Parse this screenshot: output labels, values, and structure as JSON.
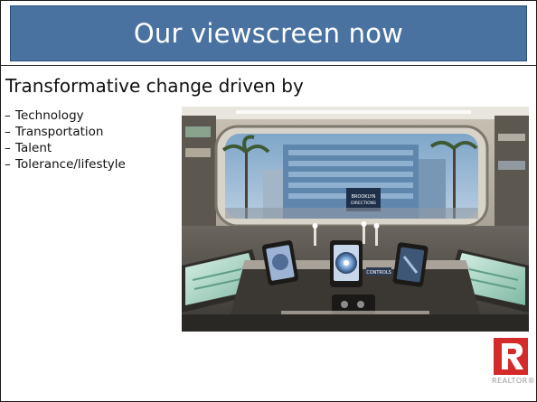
{
  "slide": {
    "title": "Our viewscreen now",
    "subheading": "Transformative change driven by",
    "bullets": [
      {
        "marker": "–",
        "text": "Technology"
      },
      {
        "marker": "–",
        "text": "Transportation"
      },
      {
        "marker": "–",
        "text": "Talent"
      },
      {
        "marker": "–",
        "text": "Tolerance/lifestyle"
      }
    ],
    "photo_text": {
      "building_sign": "BROOKLYN",
      "building_sign2": "DIRECTIONS",
      "console_label": "CONTROLS"
    },
    "logo": {
      "letter": "R",
      "word": "REALTOR®"
    }
  },
  "colors": {
    "title_bar": "#4a72a0",
    "title_text": "#ffffff",
    "logo_red": "#d52a2a"
  }
}
